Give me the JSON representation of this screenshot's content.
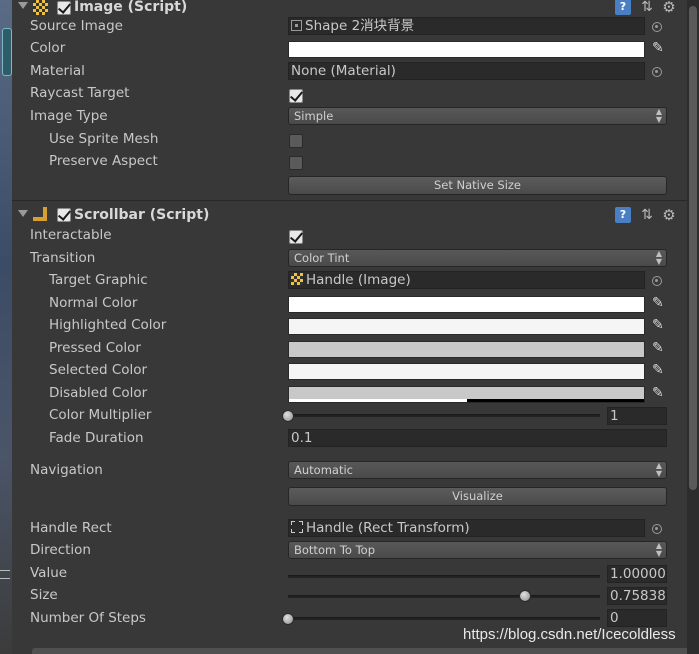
{
  "image_component": {
    "title": "Image (Script)",
    "enabled": true,
    "rows": {
      "source_image": {
        "label": "Source Image",
        "value": "Shape 2消块背景"
      },
      "color": {
        "label": "Color",
        "value": "#ffffff"
      },
      "material": {
        "label": "Material",
        "value": "None (Material)"
      },
      "raycast_target": {
        "label": "Raycast Target",
        "checked": true
      },
      "image_type": {
        "label": "Image Type",
        "value": "Simple"
      },
      "use_sprite_mesh": {
        "label": "Use Sprite Mesh",
        "checked": false
      },
      "preserve_aspect": {
        "label": "Preserve Aspect",
        "checked": false
      }
    },
    "set_native_size": "Set Native Size"
  },
  "scrollbar_component": {
    "title": "Scrollbar (Script)",
    "enabled": true,
    "rows": {
      "interactable": {
        "label": "Interactable",
        "checked": true
      },
      "transition": {
        "label": "Transition",
        "value": "Color Tint"
      },
      "target_graphic": {
        "label": "Target Graphic",
        "value": "Handle (Image)"
      },
      "normal_color": {
        "label": "Normal Color",
        "value": "#ffffff"
      },
      "highlighted_color": {
        "label": "Highlighted Color",
        "value": "#f5f5f5"
      },
      "pressed_color": {
        "label": "Pressed Color",
        "value": "#c8c8c8"
      },
      "selected_color": {
        "label": "Selected Color",
        "value": "#f5f5f5"
      },
      "disabled_color": {
        "label": "Disabled Color",
        "value": "#c8c8c8",
        "alpha": 0.5
      },
      "color_multiplier": {
        "label": "Color Multiplier",
        "value": "1",
        "fraction": 0
      },
      "fade_duration": {
        "label": "Fade Duration",
        "value": "0.1"
      },
      "navigation": {
        "label": "Navigation",
        "value": "Automatic"
      },
      "handle_rect": {
        "label": "Handle Rect",
        "value": "Handle (Rect Transform)"
      },
      "direction": {
        "label": "Direction",
        "value": "Bottom To Top"
      },
      "value": {
        "label": "Value",
        "value": "1.00000",
        "fraction": 1.0
      },
      "size": {
        "label": "Size",
        "value": "0.75838",
        "fraction": 0.75838
      },
      "number_of_steps": {
        "label": "Number Of Steps",
        "value": "0",
        "fraction": 0
      }
    },
    "visualize": "Visualize"
  },
  "watermark": "https://blog.csdn.net/Icecoldless",
  "icons": [
    "help-icon",
    "preset-icon",
    "gear-icon",
    "color-picker-icon",
    "object-picker-icon"
  ]
}
